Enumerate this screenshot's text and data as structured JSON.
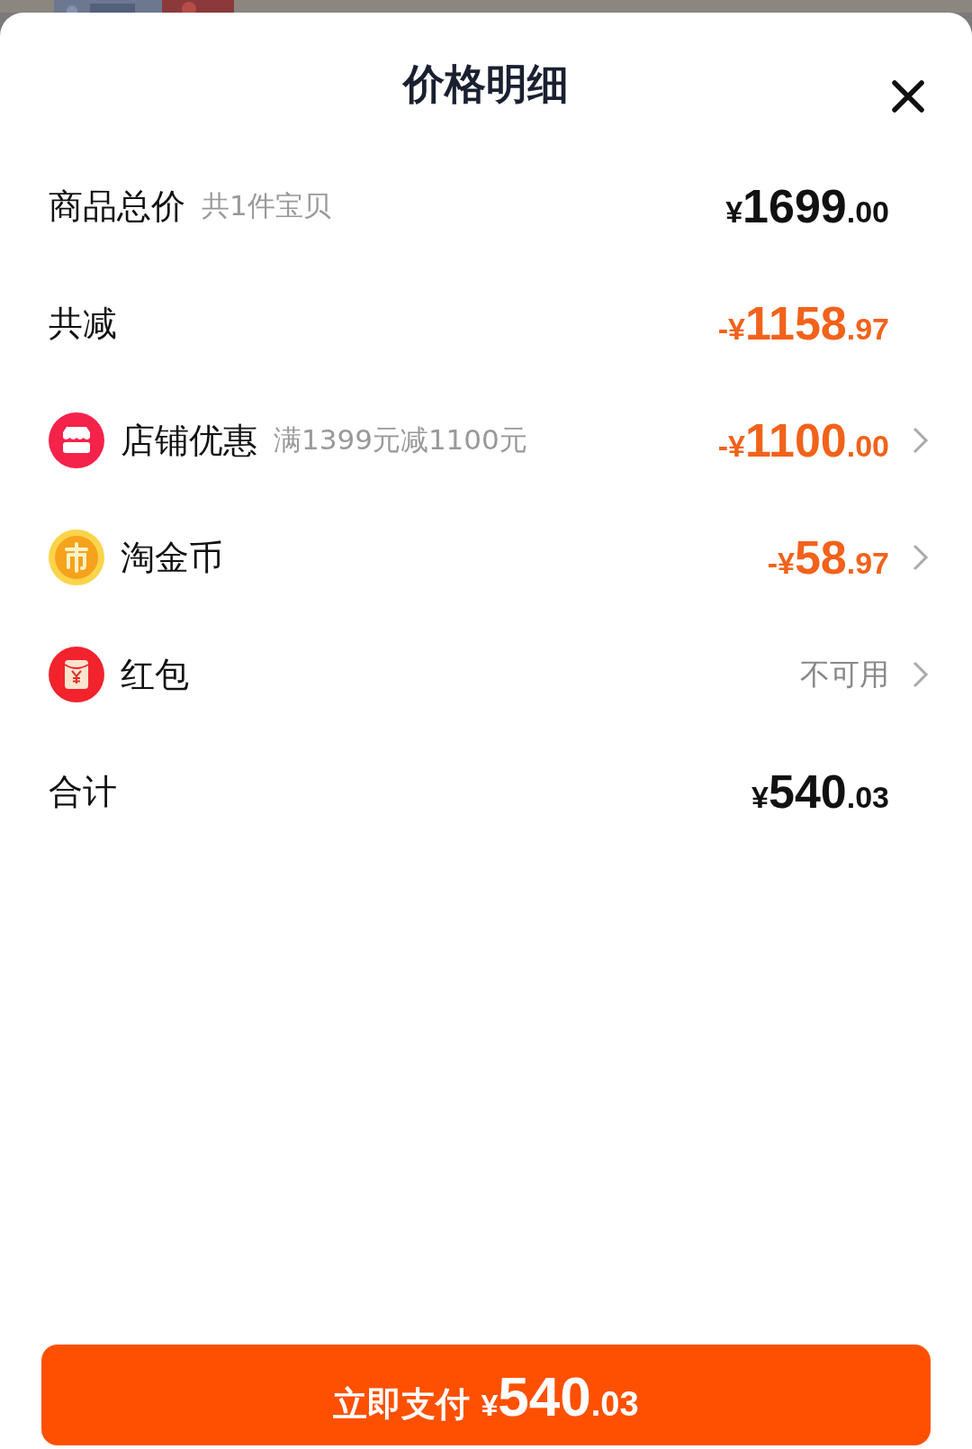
{
  "sheet": {
    "title": "价格明细"
  },
  "rows": [
    {
      "kind": "plain",
      "label": "商品总价",
      "note": "共1件宝贝",
      "amount": "¥1699.00",
      "highlighted": false,
      "has_arrow": false
    },
    {
      "kind": "plain",
      "label": "共减",
      "amount": "-¥1158.97",
      "highlighted": true,
      "has_arrow": false
    },
    {
      "kind": "shop",
      "label": "店铺优惠",
      "note": "满1399元减1100元",
      "amount": "-¥1100.00",
      "highlighted": true,
      "has_arrow": true
    },
    {
      "kind": "coin",
      "label": "淘金币",
      "amount": "-¥58.97",
      "highlighted": true,
      "has_arrow": true
    },
    {
      "kind": "red-packet",
      "label": "红包",
      "status": "不可用",
      "has_arrow": true
    },
    {
      "kind": "plain",
      "label": "合计",
      "amount": "¥540.03",
      "highlighted": false,
      "has_arrow": false
    }
  ],
  "pay_button": {
    "label": "立即支付",
    "amount": "¥540.03"
  }
}
